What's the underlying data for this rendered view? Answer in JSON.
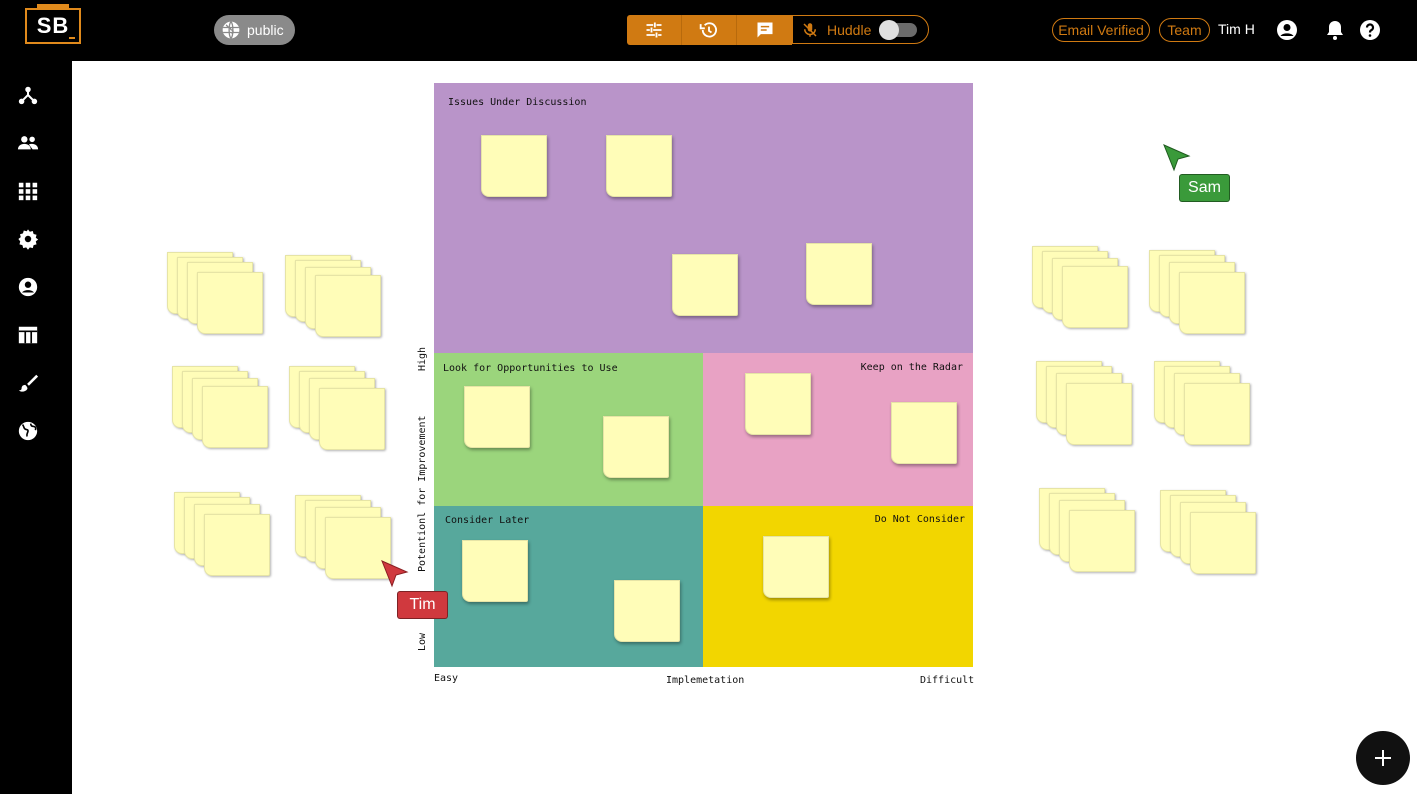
{
  "header": {
    "logo_text": "SB",
    "visibility_label": "public",
    "huddle_label": "Huddle",
    "email_verified_label": "Email Verified",
    "team_label": "Team",
    "user_name": "Tim H",
    "huddle_enabled": false,
    "accent_color": "#d07a12"
  },
  "sidebar": {
    "icons": [
      "network-icon",
      "people-icon",
      "apps-grid-icon",
      "gear-icon",
      "account-circle-icon",
      "table-layout-icon",
      "brush-icon",
      "globe-icon"
    ]
  },
  "board": {
    "quadrants": {
      "top": {
        "label": "Issues Under Discussion",
        "color": "#b994c9"
      },
      "middle_left": {
        "label": "Look for Opportunities to Use",
        "color": "#9bd57c"
      },
      "middle_right": {
        "label": "Keep on the Radar",
        "color": "#e8a2c4"
      },
      "bottom_left": {
        "label": "Consider Later",
        "color": "#57a89c"
      },
      "bottom_right": {
        "label": "Do Not Consider",
        "color": "#f2d600"
      }
    },
    "y_axis": {
      "label": "Potentionl for Improvement",
      "high": "High",
      "low": "Low"
    },
    "x_axis": {
      "label": "Implemetation",
      "easy": "Easy",
      "difficult": "Difficult"
    }
  },
  "cursors": {
    "tim": {
      "label": "Tim",
      "color": "#d0393e"
    },
    "sam": {
      "label": "Sam",
      "color": "#3a9a3a"
    }
  }
}
